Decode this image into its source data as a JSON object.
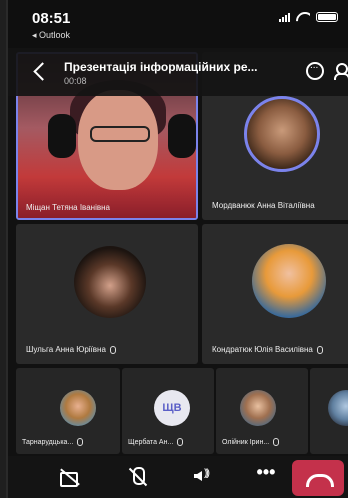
{
  "status_bar": {
    "time": "08:51",
    "back_app": "◂ Outlook"
  },
  "header": {
    "title": "Презентація інформаційних ре...",
    "timer": "00:08"
  },
  "participants": {
    "speaker": {
      "name": "Міщан Тетяна Іванівна"
    },
    "top_right": {
      "name": "Мордванюк Анна Віталіївна"
    },
    "mid_left": {
      "name": "Шульга Анна Юріївна"
    },
    "mid_right": {
      "name": "Кондратюк Юлія Василівна"
    },
    "row": [
      {
        "name": "Тарнарудцька..."
      },
      {
        "name": "Щербата Ан...",
        "initials": "ЩВ"
      },
      {
        "name": "Олійник Ірин..."
      },
      {
        "name": ""
      }
    ]
  },
  "controls": {
    "more_label": "•••"
  },
  "colors": {
    "accent": "#7b83eb",
    "hangup": "#c4314b"
  }
}
